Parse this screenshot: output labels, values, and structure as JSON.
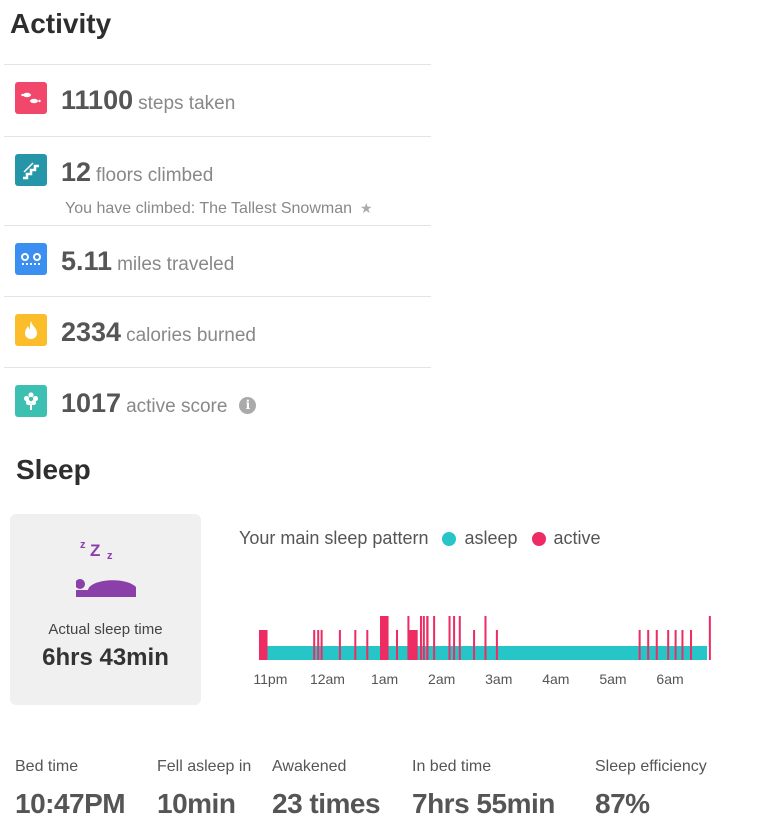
{
  "activity": {
    "title": "Activity",
    "rows": [
      {
        "value": "11100",
        "label": "steps taken",
        "icon": "footsteps-icon",
        "color": "#f0476a"
      },
      {
        "value": "12",
        "label": "floors climbed",
        "sub": "You have climbed: The Tallest Snowman",
        "icon": "stairs-icon",
        "color": "#2596a8"
      },
      {
        "value": "5.11",
        "label": "miles traveled",
        "icon": "distance-icon",
        "color": "#3b8ff0"
      },
      {
        "value": "2334",
        "label": "calories burned",
        "icon": "flame-icon",
        "color": "#fbbd2a"
      },
      {
        "value": "1017",
        "label": "active score",
        "icon": "flower-icon",
        "color": "#3dbfb2"
      }
    ]
  },
  "sleep": {
    "title": "Sleep",
    "actual_label": "Actual sleep time",
    "actual_value": "6hrs 43min",
    "bed_icon_color": "#8b3fa8",
    "legend": {
      "title": "Your main sleep pattern",
      "asleep": "asleep",
      "active": "active",
      "asleep_color": "#26c6c8",
      "active_color": "#ec2c63"
    },
    "stats": [
      {
        "label": "Bed time",
        "value": "10:47PM"
      },
      {
        "label": "Fell asleep in",
        "value": "10min"
      },
      {
        "label": "Awakened",
        "value": "23 times"
      },
      {
        "label": "In bed time",
        "value": "7hrs 55min"
      },
      {
        "label": "Sleep efficiency",
        "value": "87%"
      }
    ]
  },
  "chart_data": {
    "type": "bar",
    "title": "Your main sleep pattern",
    "x_range_hours": [
      22.783,
      30.7
    ],
    "tick_labels": [
      "11pm",
      "12am",
      "1am",
      "2am",
      "3am",
      "4am",
      "5am",
      "6am"
    ],
    "tick_hours": [
      23,
      24,
      25,
      26,
      27,
      28,
      29,
      30
    ],
    "series": [
      {
        "name": "asleep",
        "start": 22.95,
        "end": 30.65
      },
      {
        "name": "active",
        "events": [
          {
            "t": 22.8,
            "len": 0.15,
            "tall": false
          },
          {
            "t": 23.75,
            "len": 0.03,
            "tall": false
          },
          {
            "t": 23.82,
            "len": 0.03,
            "tall": false
          },
          {
            "t": 23.88,
            "len": 0.02,
            "tall": false
          },
          {
            "t": 24.2,
            "len": 0.02,
            "tall": false
          },
          {
            "t": 24.47,
            "len": 0.02,
            "tall": false
          },
          {
            "t": 24.68,
            "len": 0.02,
            "tall": false
          },
          {
            "t": 24.92,
            "len": 0.15,
            "tall": true
          },
          {
            "t": 25.2,
            "len": 0.02,
            "tall": false
          },
          {
            "t": 25.4,
            "len": 0.02,
            "tall": true
          },
          {
            "t": 25.43,
            "len": 0.15,
            "tall": false
          },
          {
            "t": 25.62,
            "len": 0.03,
            "tall": true
          },
          {
            "t": 25.67,
            "len": 0.03,
            "tall": true
          },
          {
            "t": 25.73,
            "len": 0.04,
            "tall": true
          },
          {
            "t": 25.85,
            "len": 0.02,
            "tall": true
          },
          {
            "t": 26.12,
            "len": 0.03,
            "tall": true
          },
          {
            "t": 26.2,
            "len": 0.03,
            "tall": true
          },
          {
            "t": 26.3,
            "len": 0.02,
            "tall": true
          },
          {
            "t": 26.55,
            "len": 0.02,
            "tall": false
          },
          {
            "t": 26.75,
            "len": 0.02,
            "tall": true
          },
          {
            "t": 26.95,
            "len": 0.02,
            "tall": false
          },
          {
            "t": 29.45,
            "len": 0.02,
            "tall": false
          },
          {
            "t": 29.6,
            "len": 0.02,
            "tall": false
          },
          {
            "t": 29.75,
            "len": 0.02,
            "tall": false
          },
          {
            "t": 29.95,
            "len": 0.02,
            "tall": false
          },
          {
            "t": 30.08,
            "len": 0.02,
            "tall": false
          },
          {
            "t": 30.2,
            "len": 0.02,
            "tall": false
          },
          {
            "t": 30.35,
            "len": 0.02,
            "tall": false
          },
          {
            "t": 30.68,
            "len": 0.02,
            "tall": true
          }
        ]
      }
    ]
  }
}
